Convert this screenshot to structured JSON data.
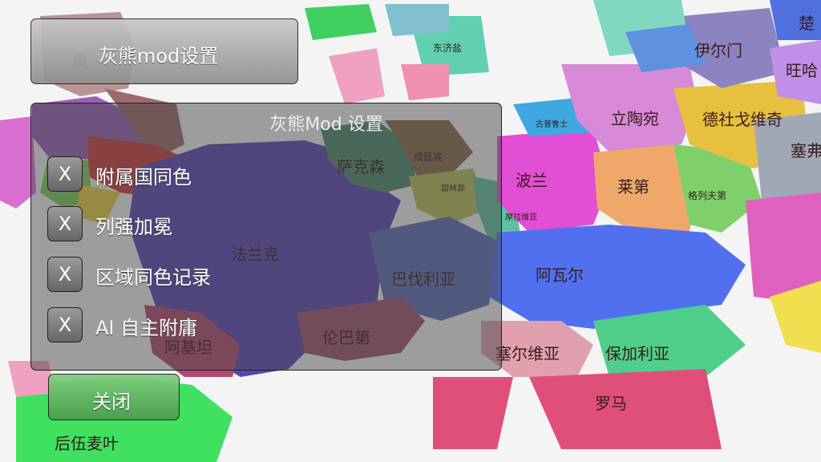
{
  "colors": {
    "map_bg": "#f4f4f4",
    "panel_bg": "rgba(70,70,70,0.5)",
    "button_top": "#c9c9c9",
    "close_green": "#5fb05f"
  },
  "map": {
    "labels": {
      "falanke": "法兰克",
      "sakesen": "萨克森",
      "chengzhidi": "成廷底",
      "bofaliya": "巴伐利亚",
      "lunbadi": "伦巴第",
      "ajitan": "阿基坦",
      "bolan": "波兰",
      "awaer": "阿瓦尔",
      "saierweiya": "塞尔维亚",
      "baojialiya": "保加利亚",
      "luoma": "罗马",
      "laidi": "莱第",
      "litaowan": "立陶宛",
      "deshegewei": "德社戈维奇",
      "yiermen": "伊尔门",
      "dongjiyi": "东济盐",
      "houwumaiye": "后伍麦叶",
      "wangha": "旺哈",
      "saifu": "塞弗",
      "chu": "楚",
      "pi": "皮",
      "guolinbu": "国林部",
      "gepu": "古普鲁士",
      "gelie": "格列夫第",
      "moxi": "摩拉维亚"
    }
  },
  "title_button": {
    "label": "灰熊mod设置"
  },
  "panel": {
    "title": "灰熊Mod 设置",
    "options": [
      {
        "checkbox": "X",
        "label": "附属国同色"
      },
      {
        "checkbox": "X",
        "label": "列强加冕"
      },
      {
        "checkbox": "X",
        "label": "区域同色记录"
      },
      {
        "checkbox": "X",
        "label": "AI 自主附庸"
      }
    ]
  },
  "close_button": {
    "label": "关闭"
  }
}
